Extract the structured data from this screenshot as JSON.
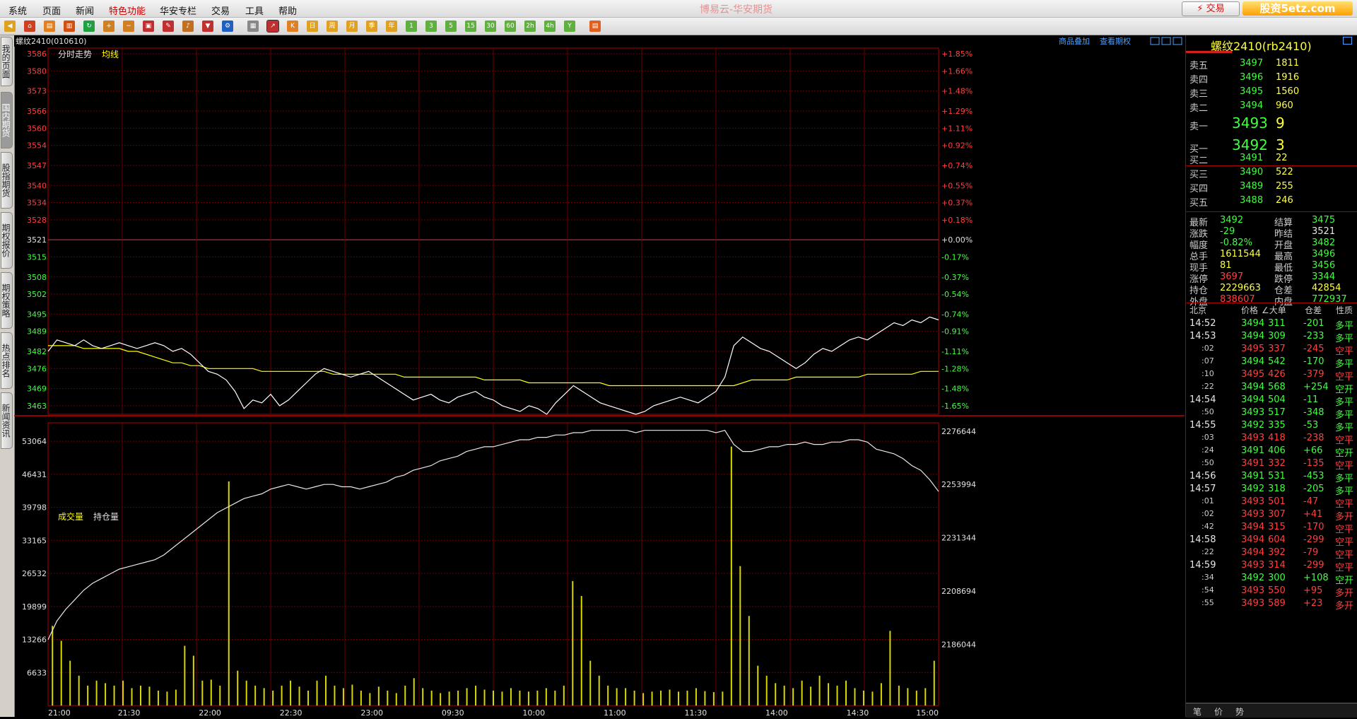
{
  "menu": [
    "系统",
    "页面",
    "新闻",
    "特色功能",
    "华安专栏",
    "交易",
    "工具",
    "帮助"
  ],
  "app_title": "博易云-华安期货",
  "trade_button": "⚡ 交易",
  "watermark": "股资5etz.com",
  "left_tabs": [
    "我的页面",
    "国内期货",
    "股指期货",
    "期权报价",
    "期权策略",
    "热点排名",
    "新闻资讯"
  ],
  "chart": {
    "contract_label": "螺纹2410(010610)",
    "link_overlay": "商品叠加",
    "link_options": "查看期权",
    "price_tag": "分时走势",
    "avg_tag": "均线",
    "vol_tag": "成交量",
    "oi_tag": "持仓量",
    "price_ticks": [
      "3586",
      "3580",
      "3573",
      "3566",
      "3560",
      "3554",
      "3547",
      "3540",
      "3534",
      "3528",
      "3521",
      "3515",
      "3508",
      "3502",
      "3495",
      "3489",
      "3482",
      "3476",
      "3469",
      "3463"
    ],
    "pct_ticks": [
      "+1.85%",
      "+1.66%",
      "+1.48%",
      "+1.29%",
      "+1.11%",
      "+0.92%",
      "+0.74%",
      "+0.55%",
      "+0.37%",
      "+0.18%",
      "+0.00%",
      "-0.17%",
      "-0.37%",
      "-0.54%",
      "-0.74%",
      "-0.91%",
      "-1.11%",
      "-1.28%",
      "-1.48%",
      "-1.65%"
    ],
    "vol_ticks": [
      "53064",
      "46431",
      "39798",
      "33165",
      "26532",
      "19899",
      "13266",
      "6633"
    ],
    "oi_ticks": [
      "2276644",
      "2253994",
      "2231344",
      "2208694",
      "2186044"
    ],
    "time_ticks": [
      "21:00",
      "21:30",
      "22:00",
      "22:30",
      "23:00",
      "09:30",
      "10:00",
      "11:00",
      "11:30",
      "14:00",
      "14:30",
      "15:00"
    ],
    "chart_data": {
      "type": "line",
      "prev_settle": 3521,
      "ylim": [
        3460,
        3588
      ],
      "series": [
        {
          "name": "分时走势",
          "values": [
            3482,
            3486,
            3485,
            3484,
            3486,
            3484,
            3483,
            3484,
            3485,
            3484,
            3483,
            3484,
            3485,
            3484,
            3482,
            3483,
            3481,
            3478,
            3475,
            3474,
            3472,
            3468,
            3462,
            3465,
            3464,
            3467,
            3463,
            3465,
            3468,
            3471,
            3474,
            3476,
            3475,
            3474,
            3473,
            3474,
            3475,
            3473,
            3471,
            3469,
            3467,
            3465,
            3466,
            3467,
            3465,
            3464,
            3466,
            3467,
            3468,
            3466,
            3465,
            3463,
            3462,
            3461,
            3463,
            3462,
            3460,
            3464,
            3467,
            3470,
            3468,
            3466,
            3464,
            3463,
            3462,
            3461,
            3460,
            3461,
            3463,
            3464,
            3465,
            3466,
            3465,
            3464,
            3466,
            3468,
            3473,
            3484,
            3487,
            3485,
            3483,
            3482,
            3480,
            3478,
            3476,
            3478,
            3481,
            3483,
            3482,
            3484,
            3486,
            3487,
            3486,
            3488,
            3490,
            3492,
            3491,
            3493,
            3492,
            3494,
            3493
          ]
        },
        {
          "name": "均线",
          "values": [
            3484,
            3484,
            3484,
            3484,
            3483,
            3483,
            3483,
            3483,
            3483,
            3482,
            3482,
            3481,
            3480,
            3479,
            3478,
            3478,
            3477,
            3477,
            3476,
            3476,
            3476,
            3476,
            3476,
            3476,
            3475,
            3475,
            3475,
            3475,
            3475,
            3475,
            3475,
            3475,
            3474,
            3474,
            3474,
            3474,
            3474,
            3474,
            3474,
            3474,
            3473,
            3473,
            3473,
            3473,
            3473,
            3473,
            3473,
            3473,
            3473,
            3472,
            3472,
            3472,
            3472,
            3472,
            3471,
            3471,
            3471,
            3471,
            3471,
            3471,
            3471,
            3471,
            3471,
            3470,
            3470,
            3470,
            3470,
            3470,
            3470,
            3470,
            3470,
            3470,
            3470,
            3470,
            3470,
            3470,
            3470,
            3470,
            3471,
            3472,
            3472,
            3472,
            3472,
            3472,
            3473,
            3473,
            3473,
            3473,
            3473,
            3473,
            3473,
            3473,
            3474,
            3474,
            3474,
            3474,
            3474,
            3474,
            3475,
            3475,
            3475
          ]
        },
        {
          "name": "持仓量",
          "values": [
            2188000,
            2196000,
            2201000,
            2205000,
            2209000,
            2212000,
            2214000,
            2216000,
            2218000,
            2219000,
            2220000,
            2221000,
            2222000,
            2224000,
            2227000,
            2230000,
            2233000,
            2236000,
            2239000,
            2242000,
            2244000,
            2246000,
            2248000,
            2249000,
            2250000,
            2252000,
            2253000,
            2254000,
            2253000,
            2252000,
            2253000,
            2254000,
            2254000,
            2253000,
            2253000,
            2252000,
            2253000,
            2254000,
            2255000,
            2257000,
            2258000,
            2260000,
            2261000,
            2262000,
            2264000,
            2265000,
            2266000,
            2268000,
            2269000,
            2270000,
            2270000,
            2271000,
            2272000,
            2273000,
            2273000,
            2274000,
            2274000,
            2275000,
            2275000,
            2276000,
            2276000,
            2277000,
            2277000,
            2277000,
            2277000,
            2277000,
            2276000,
            2277000,
            2277000,
            2277000,
            2277000,
            2277000,
            2277000,
            2277000,
            2277000,
            2276000,
            2277000,
            2271000,
            2268000,
            2268000,
            2269000,
            2270000,
            2270000,
            2271000,
            2271000,
            2272000,
            2271000,
            2271000,
            2272000,
            2272000,
            2273000,
            2273000,
            2272000,
            2269000,
            2268000,
            2267000,
            2265000,
            2262000,
            2260000,
            2256000,
            2251000
          ]
        }
      ],
      "volume": [
        16000,
        13000,
        9000,
        6000,
        4000,
        5000,
        4500,
        4000,
        5000,
        3500,
        4000,
        3800,
        3000,
        2800,
        3200,
        12000,
        10000,
        5000,
        5200,
        4000,
        45000,
        7000,
        5000,
        4000,
        3500,
        3000,
        4000,
        5000,
        3800,
        3000,
        5000,
        6000,
        4000,
        3500,
        4200,
        3000,
        2500,
        3800,
        3000,
        2500,
        4000,
        5500,
        3500,
        3000,
        2500,
        2800,
        3000,
        3500,
        4000,
        3200,
        3000,
        2800,
        3500,
        3000,
        2800,
        3000,
        3500,
        3000,
        4000,
        25000,
        22000,
        9000,
        6000,
        4000,
        3500,
        3500,
        3000,
        2500,
        2800,
        3000,
        3200,
        2800,
        3000,
        3500,
        2900,
        2700,
        2800,
        52000,
        28000,
        18000,
        8000,
        6000,
        4500,
        4000,
        3500,
        5000,
        3800,
        6000,
        4500,
        4000,
        5000,
        3500,
        3000,
        2800,
        4500,
        15000,
        4000,
        3500,
        3000,
        3500,
        9000
      ]
    }
  },
  "quote": {
    "title": "螺纹2410(rb2410)",
    "asks": [
      {
        "label": "卖五",
        "price": "3497",
        "vol": "1811"
      },
      {
        "label": "卖四",
        "price": "3496",
        "vol": "1916"
      },
      {
        "label": "卖三",
        "price": "3495",
        "vol": "1560"
      },
      {
        "label": "卖二",
        "price": "3494",
        "vol": "960"
      },
      {
        "label": "卖一",
        "price": "3493",
        "vol": "9"
      }
    ],
    "bids": [
      {
        "label": "买一",
        "price": "3492",
        "vol": "3"
      },
      {
        "label": "买二",
        "price": "3491",
        "vol": "22"
      },
      {
        "label": "买三",
        "price": "3490",
        "vol": "522"
      },
      {
        "label": "买四",
        "price": "3489",
        "vol": "255"
      },
      {
        "label": "买五",
        "price": "3488",
        "vol": "246"
      }
    ],
    "stats": [
      {
        "l1": "最新",
        "v1": "3492",
        "c1": "dn",
        "l2": "结算",
        "v2": "3475",
        "c2": "dn"
      },
      {
        "l1": "涨跌",
        "v1": "-29",
        "c1": "dn",
        "l2": "昨结",
        "v2": "3521",
        "c2": "wh"
      },
      {
        "l1": "幅度",
        "v1": "-0.82%",
        "c1": "dn",
        "l2": "开盘",
        "v2": "3482",
        "c2": "dn"
      },
      {
        "l1": "总手",
        "v1": "1611544",
        "c1": "yl",
        "l2": "最高",
        "v2": "3496",
        "c2": "dn"
      },
      {
        "l1": "现手",
        "v1": "81",
        "c1": "yl",
        "l2": "最低",
        "v2": "3456",
        "c2": "dn"
      },
      {
        "l1": "涨停",
        "v1": "3697",
        "c1": "up",
        "l2": "跌停",
        "v2": "3344",
        "c2": "dn"
      },
      {
        "l1": "持仓",
        "v1": "2229663",
        "c1": "yl",
        "l2": "仓差",
        "v2": "42854",
        "c2": "yl"
      },
      {
        "l1": "外盘",
        "v1": "838607",
        "c1": "up",
        "l2": "内盘",
        "v2": "772937",
        "c2": "dn"
      }
    ],
    "ticks_header": {
      "time": "北京",
      "price": "价格",
      "vol": "∠大单",
      "oi": "仓差",
      "nature": "性质"
    },
    "ticks": [
      {
        "t": "14:52",
        "p": "3494",
        "v": "311",
        "d": "-201",
        "n": "多平",
        "pc": "dn",
        "nc": "dn"
      },
      {
        "t": "14:53",
        "p": "3494",
        "v": "309",
        "d": "-233",
        "n": "多平",
        "pc": "dn",
        "nc": "dn"
      },
      {
        "t": ":02",
        "p": "3495",
        "v": "337",
        "d": "-245",
        "n": "空平",
        "pc": "up",
        "nc": "up"
      },
      {
        "t": ":07",
        "p": "3494",
        "v": "542",
        "d": "-170",
        "n": "多平",
        "pc": "dn",
        "nc": "dn"
      },
      {
        "t": ":10",
        "p": "3495",
        "v": "426",
        "d": "-379",
        "n": "空平",
        "pc": "up",
        "nc": "up"
      },
      {
        "t": ":22",
        "p": "3494",
        "v": "568",
        "d": "+254",
        "n": "空开",
        "pc": "dn",
        "nc": "dn"
      },
      {
        "t": "14:54",
        "p": "3494",
        "v": "504",
        "d": "-11",
        "n": "多平",
        "pc": "dn",
        "nc": "dn"
      },
      {
        "t": ":50",
        "p": "3493",
        "v": "517",
        "d": "-348",
        "n": "多平",
        "pc": "dn",
        "nc": "dn"
      },
      {
        "t": "14:55",
        "p": "3492",
        "v": "335",
        "d": "-53",
        "n": "多平",
        "pc": "dn",
        "nc": "dn"
      },
      {
        "t": ":03",
        "p": "3493",
        "v": "418",
        "d": "-238",
        "n": "空平",
        "pc": "up",
        "nc": "up"
      },
      {
        "t": ":24",
        "p": "3491",
        "v": "406",
        "d": "+66",
        "n": "空开",
        "pc": "dn",
        "nc": "dn"
      },
      {
        "t": ":50",
        "p": "3491",
        "v": "332",
        "d": "-135",
        "n": "空平",
        "pc": "up",
        "nc": "up"
      },
      {
        "t": "14:56",
        "p": "3491",
        "v": "531",
        "d": "-453",
        "n": "多平",
        "pc": "dn",
        "nc": "dn"
      },
      {
        "t": "14:57",
        "p": "3492",
        "v": "318",
        "d": "-205",
        "n": "多平",
        "pc": "dn",
        "nc": "dn"
      },
      {
        "t": ":01",
        "p": "3493",
        "v": "501",
        "d": "-47",
        "n": "空平",
        "pc": "up",
        "nc": "up"
      },
      {
        "t": ":02",
        "p": "3493",
        "v": "307",
        "d": "+41",
        "n": "多开",
        "pc": "up",
        "nc": "up"
      },
      {
        "t": ":42",
        "p": "3494",
        "v": "315",
        "d": "-170",
        "n": "空平",
        "pc": "up",
        "nc": "up"
      },
      {
        "t": "14:58",
        "p": "3494",
        "v": "604",
        "d": "-299",
        "n": "空平",
        "pc": "up",
        "nc": "up"
      },
      {
        "t": ":22",
        "p": "3494",
        "v": "392",
        "d": "-79",
        "n": "空平",
        "pc": "up",
        "nc": "up"
      },
      {
        "t": "14:59",
        "p": "3493",
        "v": "314",
        "d": "-299",
        "n": "空平",
        "pc": "up",
        "nc": "up"
      },
      {
        "t": ":34",
        "p": "3492",
        "v": "300",
        "d": "+108",
        "n": "空开",
        "pc": "dn",
        "nc": "dn"
      },
      {
        "t": ":54",
        "p": "3493",
        "v": "550",
        "d": "+95",
        "n": "多开",
        "pc": "up",
        "nc": "up"
      },
      {
        "t": ":55",
        "p": "3493",
        "v": "589",
        "d": "+23",
        "n": "多开",
        "pc": "up",
        "nc": "up"
      }
    ],
    "bottom_tabs": [
      "笔",
      "价",
      "势"
    ]
  },
  "colors": {
    "up": "#ff4040",
    "down": "#40ff40",
    "grid": "#8a0000",
    "price": "#ffffff",
    "avg": "#ffff00",
    "volume": "#d8d800"
  }
}
